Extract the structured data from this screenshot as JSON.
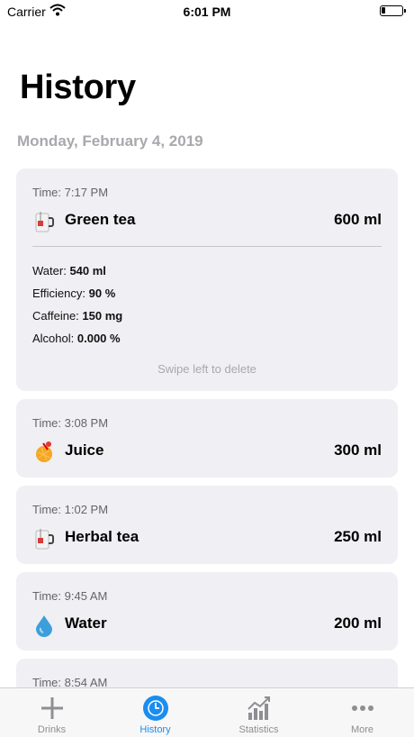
{
  "status_bar": {
    "carrier": "Carrier",
    "time": "6:01 PM",
    "battery_level": 0.2
  },
  "page_title": "History",
  "section_date": "Monday, February 4, 2019",
  "entries": [
    {
      "time": "Time: 7:17 PM",
      "name": "Green tea",
      "amount": "600 ml",
      "icon": "tea-mug-icon",
      "details": [
        {
          "label": "Water:",
          "value": "540 ml"
        },
        {
          "label": "Efficiency:",
          "value": "90 %"
        },
        {
          "label": "Caffeine:",
          "value": "150 mg"
        },
        {
          "label": "Alcohol:",
          "value": "0.000 %"
        }
      ],
      "hint": "Swipe left to delete"
    },
    {
      "time": "Time: 3:08 PM",
      "name": "Juice",
      "amount": "300 ml",
      "icon": "juice-icon"
    },
    {
      "time": "Time: 1:02 PM",
      "name": "Herbal tea",
      "amount": "250 ml",
      "icon": "tea-mug-icon"
    },
    {
      "time": "Time: 9:45 AM",
      "name": "Water",
      "amount": "200 ml",
      "icon": "water-drop-icon"
    },
    {
      "time": "Time: 8:54 AM"
    }
  ],
  "tabs": [
    {
      "label": "Drinks",
      "icon": "plus-icon"
    },
    {
      "label": "History",
      "icon": "clock-icon",
      "active": true
    },
    {
      "label": "Statistics",
      "icon": "chart-icon"
    },
    {
      "label": "More",
      "icon": "more-dots-icon"
    }
  ],
  "colors": {
    "accent": "#1a8df0",
    "card": "#efeff4",
    "secondary_text": "#a8a8ad"
  }
}
